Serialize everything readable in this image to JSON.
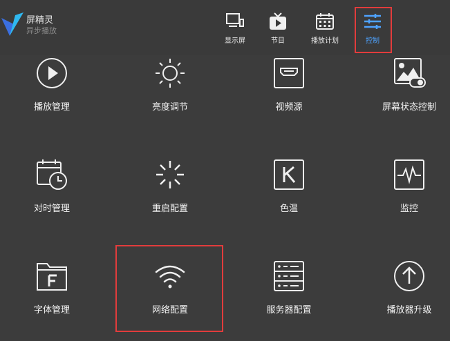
{
  "app": {
    "name": "屏精灵",
    "subtitle": "异步播放"
  },
  "nav": [
    {
      "id": "display",
      "label": "显示屏",
      "icon": "display-icon"
    },
    {
      "id": "program",
      "label": "节目",
      "icon": "tv-play-icon"
    },
    {
      "id": "schedule",
      "label": "播放计划",
      "icon": "calendar-icon"
    },
    {
      "id": "control",
      "label": "控制",
      "icon": "sliders-icon",
      "active": true
    }
  ],
  "tiles": [
    {
      "label": "播放管理",
      "icon": "play-circle-icon"
    },
    {
      "label": "亮度调节",
      "icon": "sun-icon"
    },
    {
      "label": "视频源",
      "icon": "hdmi-icon"
    },
    {
      "label": "屏幕状态控制",
      "icon": "screen-status-icon"
    },
    {
      "label": "对时管理",
      "icon": "calendar-clock-icon"
    },
    {
      "label": "重启配置",
      "icon": "loading-spinner-icon"
    },
    {
      "label": "色温",
      "icon": "k-box-icon"
    },
    {
      "label": "监控",
      "icon": "pulse-monitor-icon"
    },
    {
      "label": "字体管理",
      "icon": "font-folder-icon"
    },
    {
      "label": "网络配置",
      "icon": "wifi-icon"
    },
    {
      "label": "服务器配置",
      "icon": "server-icon"
    },
    {
      "label": "播放器升级",
      "icon": "upgrade-arrow-icon"
    }
  ],
  "colors": {
    "accent": "#4ea3ff",
    "highlight": "#e23c3c",
    "background": "#3c3c3c"
  }
}
